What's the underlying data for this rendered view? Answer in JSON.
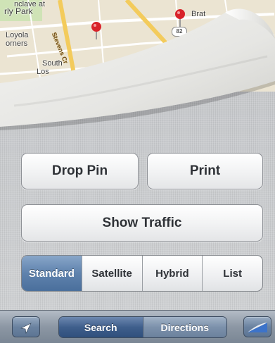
{
  "map": {
    "labels": {
      "park": "rly Park",
      "enclave": "nclave at",
      "loyola": "Loyola",
      "corners": "orners",
      "south": "South",
      "los": "Los",
      "brat": "Brat",
      "stevens": "Stevens Cr"
    },
    "route_shield": "82"
  },
  "buttons": {
    "drop_pin": "Drop Pin",
    "print": "Print",
    "show_traffic": "Show Traffic"
  },
  "map_type": {
    "options": [
      "Standard",
      "Satellite",
      "Hybrid",
      "List"
    ],
    "selected": "Standard"
  },
  "toolbar": {
    "tabs": [
      "Search",
      "Directions"
    ],
    "selected": "Search",
    "icons": {
      "locate": "location-arrow-icon",
      "curl": "page-curl-icon"
    }
  },
  "colors": {
    "accent": "#5f82ad",
    "toolbar": "#8c97a4",
    "pin": "#d8232a"
  }
}
